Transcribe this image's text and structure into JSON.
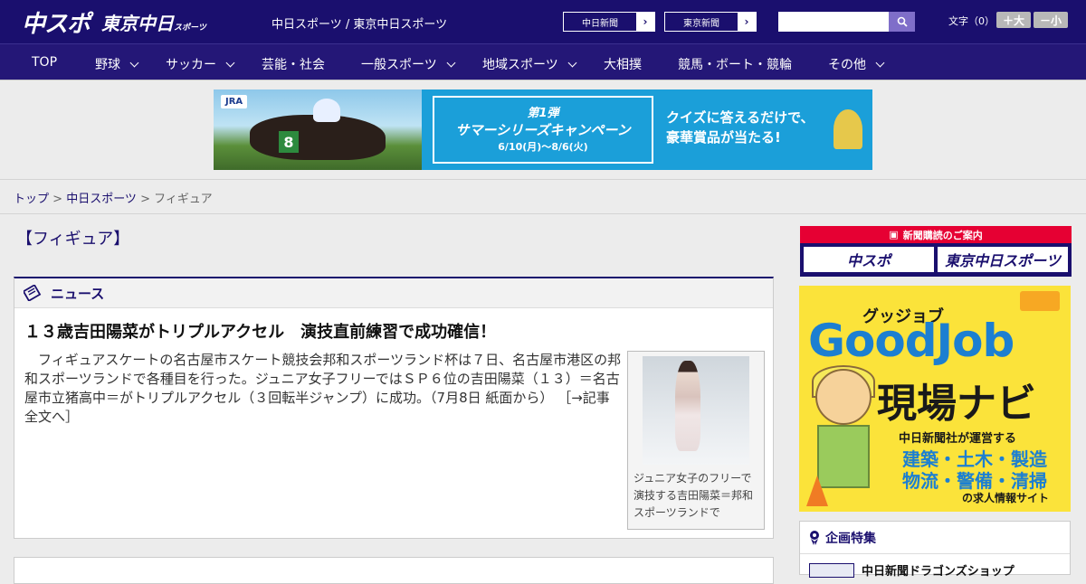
{
  "header": {
    "logo_chuspo": "中スポ",
    "logo_tokyo": "東京中日",
    "logo_tokyo_small": "スポーツ",
    "site_title": "中日スポーツ / 東京中日スポーツ",
    "paper_links": [
      "中日新聞",
      "東京新聞"
    ],
    "search": {
      "placeholder": "",
      "value": ""
    },
    "font_size_label": "文字（0）",
    "font_larger": "＋大",
    "font_smaller": "－小"
  },
  "nav": {
    "items": [
      {
        "label": "TOP",
        "dropdown": false
      },
      {
        "label": "野球",
        "dropdown": true
      },
      {
        "label": "サッカー",
        "dropdown": true
      },
      {
        "label": "芸能・社会",
        "dropdown": false
      },
      {
        "label": "一般スポーツ",
        "dropdown": true
      },
      {
        "label": "地域スポーツ",
        "dropdown": true
      },
      {
        "label": "大相撲",
        "dropdown": false
      },
      {
        "label": "競馬・ボート・競輪",
        "dropdown": false
      },
      {
        "label": "その他",
        "dropdown": true
      }
    ]
  },
  "banner": {
    "jra": "JRA",
    "num": "8",
    "campaign_line1": "第1弾",
    "campaign_line2": "サマーシリーズキャンペーン",
    "campaign_line3": "6/10(月)～8/6(火)",
    "quiz_line1": "クイズに答えるだけで、",
    "quiz_line2": "豪華賞品が当たる!"
  },
  "breadcrumb": {
    "items": [
      "トップ",
      "中日スポーツ",
      "フィギュア"
    ],
    "separator": " > "
  },
  "main": {
    "category_title": "【フィギュア】",
    "news_label": "ニュース",
    "article": {
      "title": "１３歳吉田陽菜がトリプルアクセル　演技直前練習で成功確信！",
      "body": "　フィギュアスケートの名古屋市スケート競技会邦和スポーツランド杯は７日、名古屋市港区の邦和スポーツランドで各種目を行った。ジュニア女子フリーではＳＰ６位の吉田陽菜（１３）＝名古屋市立猪高中＝がトリプルアクセル（３回転半ジャンプ）に成功。（7月8日 紙面から）",
      "more": "［→記事全文へ］",
      "caption": "ジュニア女子のフリーで演技する吉田陽菜＝邦和スポーツランドで"
    }
  },
  "sidebar": {
    "subscribe_bar": "新聞購読のご案内",
    "subscribe_btn1": "中スポ",
    "subscribe_btn2": "東京中日スポーツ",
    "goodjob": {
      "kana": "グッジョブ",
      "title": "GoodJob",
      "navi": "現場ナビ",
      "sub": "中日新聞社が運営する",
      "line1": "建築・土木・製造",
      "line2": "物流・警備・清掃",
      "site": "の求人情報サイト"
    },
    "special_title": "企画特集",
    "special_item": "中日新聞ドラゴンズショップ"
  },
  "colors": {
    "brand": "#1a0f6e",
    "nav": "#241777",
    "accent_red": "#e60033"
  }
}
